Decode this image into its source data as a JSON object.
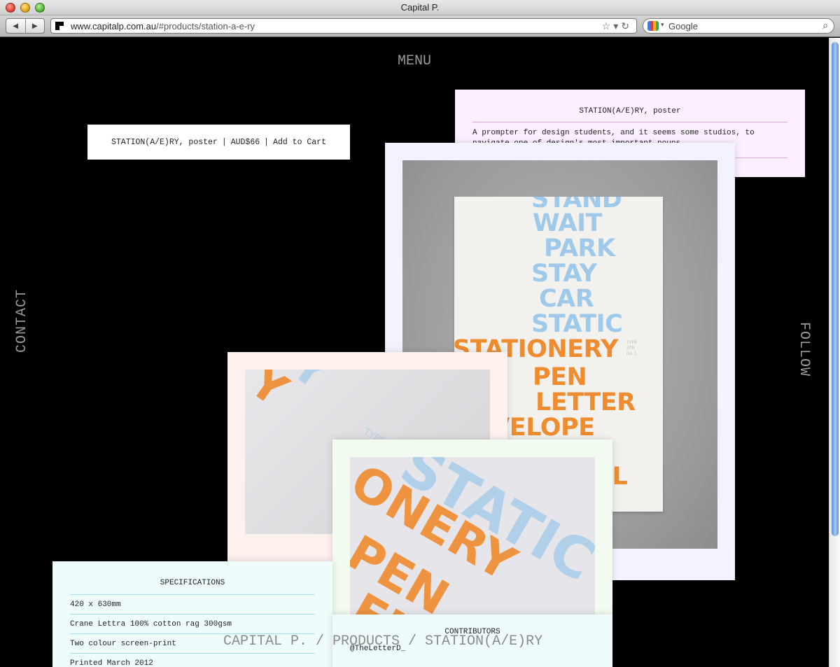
{
  "window": {
    "title": "Capital P."
  },
  "toolbar": {
    "back_icon": "back-arrow-icon",
    "forward_icon": "forward-arrow-icon",
    "url_host": "www.capitalp.com.au",
    "url_path": "/#products/station-a-e-ry",
    "search_placeholder": "Google"
  },
  "nav": {
    "menu": "MENU",
    "contact": "CONTACT",
    "follow": "FOLLOW"
  },
  "cart": {
    "product": "STATION(A/E)RY, poster",
    "price": "AUD$66",
    "add_to_cart": "Add to Cart",
    "separator": "|"
  },
  "description": {
    "title": "STATION(A/E)RY, poster",
    "text": "A prompter for design students, and it seems some studios, to navigate one of design's most important nouns."
  },
  "poster_words": {
    "blue": [
      "STAND",
      "WAIT",
      "PARK",
      "STAY",
      "CAR",
      "STATIC"
    ],
    "orange": [
      "STATIONERY",
      "PEN",
      "LETTER",
      "ENVELOPE",
      "IL"
    ],
    "tiny": [
      "TYPE",
      "STR",
      "No. 1"
    ]
  },
  "detail_words": {
    "photo2_orange": "Y",
    "photo2_blue": "TYPE",
    "photo3_blue": "STATIC",
    "photo3_orange": [
      "ONERY",
      "PEN",
      "EN"
    ]
  },
  "specifications": {
    "title": "SPECIFICATIONS",
    "rows": [
      "420 x 630mm",
      "Crane Lettra 100% cotton rag 300gsm",
      "Two colour screen-print",
      "Printed March 2012"
    ]
  },
  "contributors": {
    "title": "CONTRIBUTORS",
    "items": [
      "@TheLetterD_"
    ]
  },
  "breadcrumb": "CAPITAL P. / PRODUCTS / STATION(A/E)RY",
  "colors": {
    "background": "#000000",
    "nav_text": "#9a9a9a",
    "blue_ink": "#9fc9ea",
    "orange_ink": "#ef8c2f"
  }
}
